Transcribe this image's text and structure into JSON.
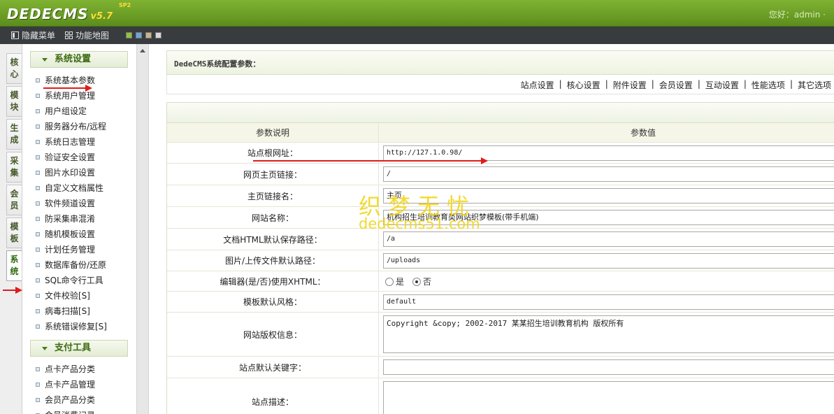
{
  "header": {
    "logo_text": "DEDECMS",
    "logo_version": "v5.7",
    "logo_edition": "SP2",
    "welcome": "您好：admin ·"
  },
  "toolbar": {
    "hide_menu": "隐藏菜单",
    "function_map": "功能地图",
    "skin_colors": [
      "#8fc43a",
      "#6aa6d9",
      "#c9b48a",
      "#d8d8d8"
    ]
  },
  "vtabs": [
    {
      "c1": "核",
      "c2": "心",
      "active": false
    },
    {
      "c1": "模",
      "c2": "块",
      "active": false
    },
    {
      "c1": "生",
      "c2": "成",
      "active": false
    },
    {
      "c1": "采",
      "c2": "集",
      "active": false
    },
    {
      "c1": "会",
      "c2": "员",
      "active": false
    },
    {
      "c1": "模",
      "c2": "板",
      "active": false
    },
    {
      "c1": "系",
      "c2": "统",
      "active": true
    }
  ],
  "menu": {
    "section1": {
      "title": "系统设置",
      "items": [
        "系统基本参数",
        "系统用户管理",
        "用户组设定",
        "服务器分布/远程",
        "系统日志管理",
        "验证安全设置",
        "图片水印设置",
        "自定义文档属性",
        "软件频道设置",
        "防采集串混淆",
        "随机模板设置",
        "计划任务管理",
        "数据库备份/还原",
        "SQL命令行工具",
        "文件校验[S]",
        "病毒扫描[S]",
        "系统错误修复[S]"
      ]
    },
    "section2": {
      "title": "支付工具",
      "items": [
        "点卡产品分类",
        "点卡产品管理",
        "会员产品分类",
        "会员消费记录"
      ]
    }
  },
  "main": {
    "title": "DedeCMS系统配置参数：",
    "tabs": [
      "站点设置",
      "核心设置",
      "附件设置",
      "会员设置",
      "互动设置",
      "性能选项",
      "其它选项"
    ],
    "table": {
      "col_label": "参数说明",
      "col_value": "参数值",
      "rows": {
        "root_url": {
          "label": "站点根网址：",
          "value": "http://127.1.0.98/"
        },
        "home_link": {
          "label": "网页主页链接：",
          "value": "/"
        },
        "home_name": {
          "label": "主页链接名：",
          "value": "主页"
        },
        "site_name": {
          "label": "网站名称：",
          "value": "机构招生培训教育类网站织梦模板(带手机端)"
        },
        "html_path": {
          "label": "文档HTML默认保存路径：",
          "value": "/a"
        },
        "upload_path": {
          "label": "图片/上传文件默认路径：",
          "value": "/uploads"
        },
        "editor_xhtml": {
          "label": "编辑器(是/否)使用XHTML：",
          "opt_yes": "是",
          "opt_no": "否",
          "selected": "否"
        },
        "template_style": {
          "label": "模板默认风格：",
          "value": "default"
        },
        "copyright": {
          "label": "网站版权信息：",
          "value": "Copyright &copy; 2002-2017 某某招生培训教育机构 版权所有"
        },
        "keywords": {
          "label": "站点默认关键字：",
          "value": ""
        },
        "description": {
          "label": "站点描述：",
          "value": ""
        }
      }
    }
  },
  "watermark": {
    "cn": "织梦无忧",
    "en": "dedecms51.com"
  }
}
